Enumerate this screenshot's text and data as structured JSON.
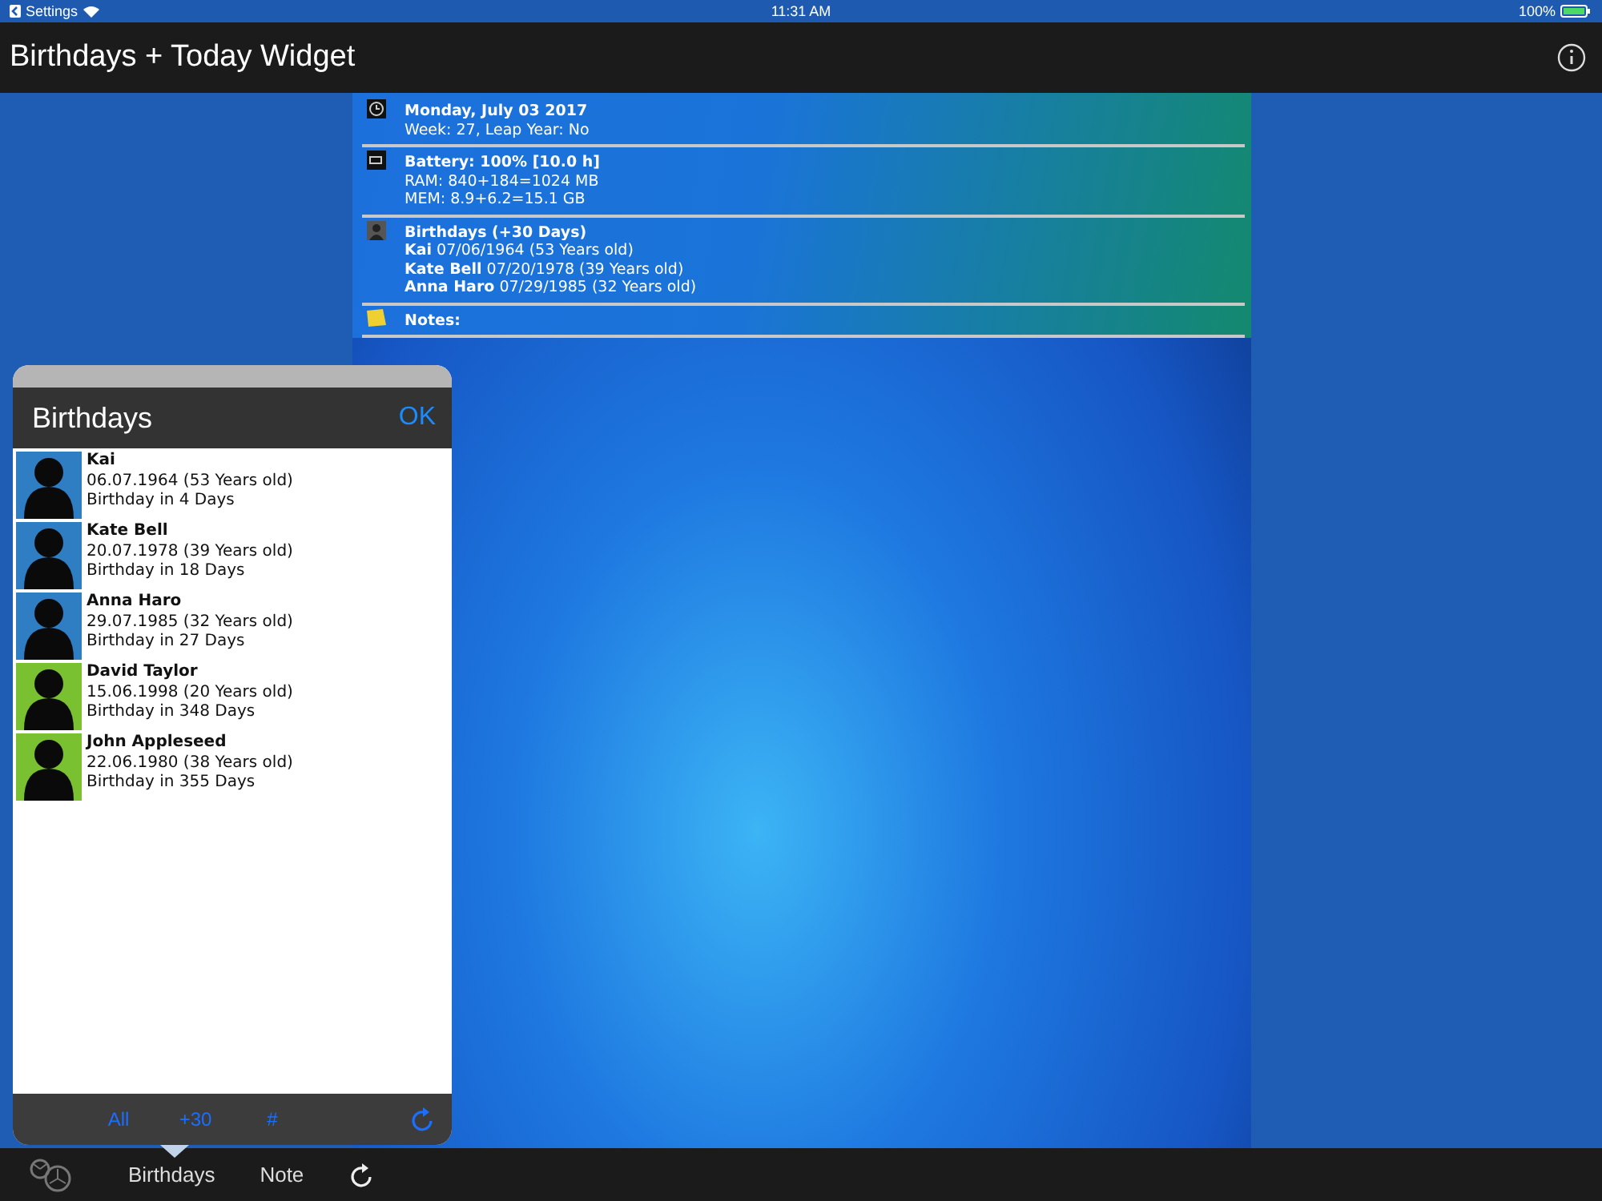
{
  "status_bar": {
    "back": "Settings",
    "time": "11:31 AM",
    "battery": "100%"
  },
  "nav_bar": {
    "title": "Birthdays + Today Widget"
  },
  "widget": {
    "sections": [
      {
        "kind": "clock",
        "title": "Monday, July 03 2017",
        "lines": [
          "Week: 27, Leap Year: No"
        ]
      },
      {
        "kind": "battery",
        "title": "Battery: 100% [10.0 h]",
        "lines": [
          "RAM: 840+184=1024 MB",
          "MEM: 8.9+6.2=15.1 GB"
        ]
      },
      {
        "kind": "person",
        "title": "Birthdays (+30 Days)",
        "lines": [
          "**Kai** 07/06/1964 (53 Years old)",
          "**Kate Bell** 07/20/1978 (39 Years old)",
          "**Anna Haro** 07/29/1985 (32 Years old)"
        ]
      },
      {
        "kind": "note",
        "title": "Notes:"
      }
    ]
  },
  "popover": {
    "title": "Birthdays",
    "ok": "OK",
    "contacts": [
      {
        "name": "Kai",
        "date": "06.07.1964 (53 Years old)",
        "countdown": "Birthday in 4 Days",
        "color": "#2f7dc3"
      },
      {
        "name": "Kate Bell",
        "date": "20.07.1978 (39 Years old)",
        "countdown": "Birthday in 18 Days",
        "color": "#2f7dc3"
      },
      {
        "name": "Anna Haro",
        "date": "29.07.1985 (32 Years old)",
        "countdown": "Birthday in 27 Days",
        "color": "#2f7dc3"
      },
      {
        "name": "David Taylor",
        "date": "15.06.1998 (20 Years old)",
        "countdown": "Birthday in 348 Days",
        "color": "#7ac131"
      },
      {
        "name": "John Appleseed",
        "date": "22.06.1980 (38 Years old)",
        "countdown": "Birthday in 355 Days",
        "color": "#7ac131"
      }
    ],
    "filters": [
      "All",
      "+30",
      "#"
    ]
  },
  "toolbar": {
    "items": [
      "Birthdays",
      "Note"
    ]
  }
}
